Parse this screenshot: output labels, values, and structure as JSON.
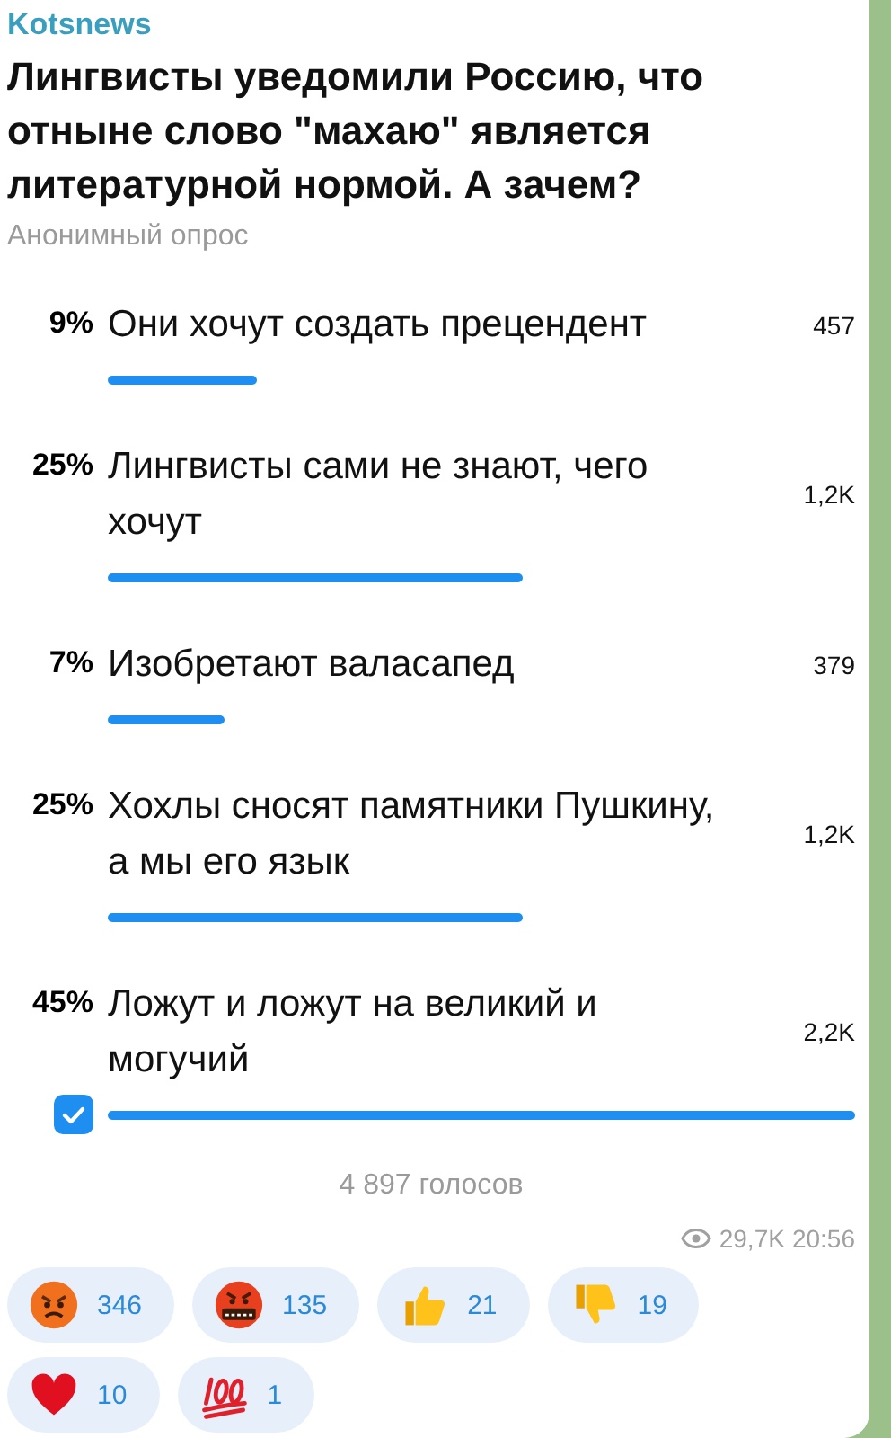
{
  "channel": "Kotsnews",
  "question": "Лингвисты уведомили Россию, что отныне слово \"махаю\" является литературной нормой. А зачем?",
  "poll_type": "Анонимный опрос",
  "options": [
    {
      "percent": "9%",
      "text": "Они хочут создать прецендент",
      "count": "457",
      "chosen": false
    },
    {
      "percent": "25%",
      "text": "Лингвисты сами не знают, чего хочут",
      "count": "1,2K",
      "chosen": false
    },
    {
      "percent": "7%",
      "text": "Изобретают валасапед",
      "count": "379",
      "chosen": false
    },
    {
      "percent": "25%",
      "text": "Хохлы сносят памятники Пушкину, а мы его язык",
      "count": "1,2K",
      "chosen": false
    },
    {
      "percent": "45%",
      "text": "Ложут и ложут на великий и могучий",
      "count": "2,2K",
      "chosen": true
    }
  ],
  "total_votes": "4 897 голосов",
  "views": "29,7K",
  "time": "20:56",
  "reactions": [
    {
      "kind": "angry",
      "count": "346"
    },
    {
      "kind": "cursing",
      "count": "135"
    },
    {
      "kind": "thumbs-up",
      "count": "21"
    },
    {
      "kind": "thumbs-down",
      "count": "19"
    },
    {
      "kind": "heart",
      "count": "10"
    },
    {
      "kind": "hundred",
      "count": "1"
    }
  ]
}
